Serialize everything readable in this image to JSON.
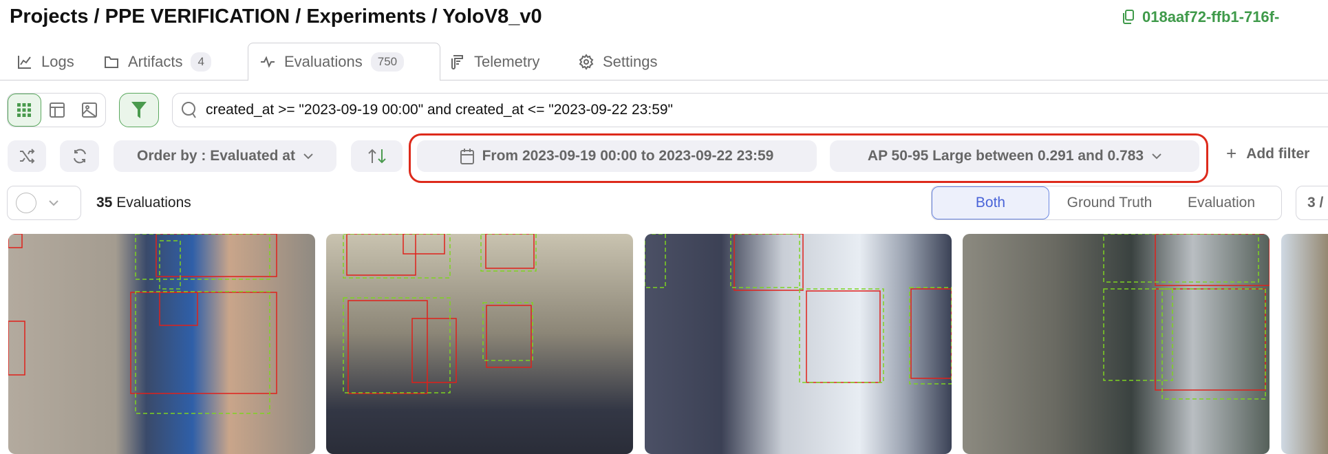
{
  "breadcrumb": "Projects / PPE VERIFICATION / Experiments / YoloV8_v0",
  "run_id": "018aaf72-ffb1-716f-",
  "tabs": [
    {
      "label": "Logs",
      "icon": "chart-line-icon"
    },
    {
      "label": "Artifacts",
      "badge": "4",
      "icon": "folder-icon"
    },
    {
      "label": "Evaluations",
      "badge": "750",
      "icon": "activity-icon",
      "active": true
    },
    {
      "label": "Telemetry",
      "icon": "scroll-icon"
    },
    {
      "label": "Settings",
      "icon": "gear-icon"
    }
  ],
  "search": {
    "query": "created_at >= \"2023-09-19 00:00\" and created_at <= \"2023-09-22 23:59\""
  },
  "toolbar": {
    "order_by": "Order by : Evaluated at",
    "date_filter": "From 2023-09-19 00:00 to 2023-09-22 23:59",
    "metric_filter": "AP 50-95 Large between 0.291 and 0.783",
    "add_filter": "Add filter"
  },
  "results": {
    "count": "35",
    "count_label": "Evaluations"
  },
  "display_mode": {
    "options": [
      "Both",
      "Ground Truth",
      "Evaluation"
    ],
    "selected": "Both"
  },
  "pager": "3 /",
  "colors": {
    "accent": "#3f9a4a",
    "highlight": "#dd2a1b",
    "ground_truth": "#7ed321",
    "prediction": "#e0201a",
    "selected": "#4a64d8"
  }
}
